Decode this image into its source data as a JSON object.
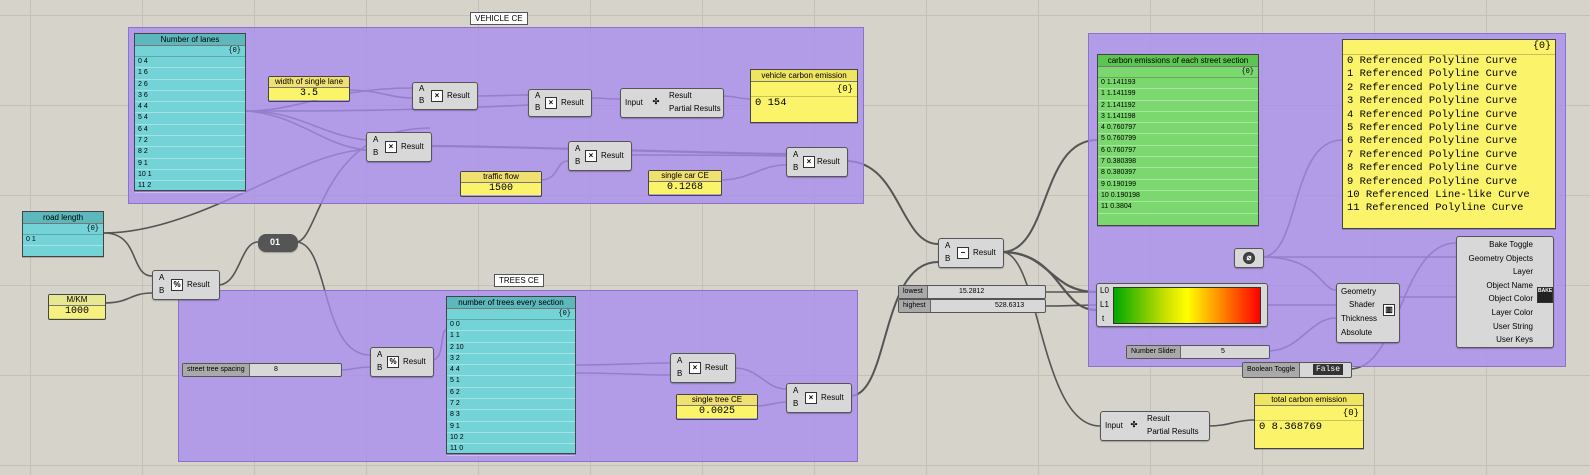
{
  "groups": {
    "vehicle_title": "VEHICLE CE",
    "trees_title": "TREES CE"
  },
  "lanes_panel": {
    "title": "Number of lanes",
    "index": "{0}",
    "rows": [
      "0 4",
      "1 6",
      "2 6",
      "3 6",
      "4 4",
      "5 4",
      "6 4",
      "7 2",
      "8 2",
      "9 1",
      "10 1",
      "11 2"
    ]
  },
  "road_length": {
    "title": "road length",
    "index": "{0}",
    "row": "0 1"
  },
  "mkm": {
    "title": "M/KM",
    "value": "1000"
  },
  "width_lane": {
    "title": "width of single lane",
    "value": "3.5"
  },
  "traffic_flow": {
    "title": "traffic flow",
    "value": "1500"
  },
  "single_car": {
    "title": "single car CE",
    "value": "0.1268"
  },
  "single_tree": {
    "title": "single tree CE",
    "value": "0.0025"
  },
  "vehicle_ce_panel": {
    "title": "vehicle carbon emission",
    "index": "{0}",
    "row": "0 154"
  },
  "total_ce_panel": {
    "title": "total carbon emission",
    "index": "{0}",
    "row": "0 8.368769"
  },
  "trees_panel": {
    "title": "number of trees every section",
    "index": "{0}",
    "rows": [
      "0 0",
      "1 1",
      "2 10",
      "3 2",
      "4 4",
      "5 1",
      "6 2",
      "7 2",
      "8 3",
      "9 1",
      "10 2",
      "11 0"
    ]
  },
  "ce_section_panel": {
    "title": "carbon emissions of each street section",
    "index": "{0}",
    "rows": [
      "0 1.141193",
      "1 1.141199",
      "2 1.141192",
      "3 1.141198",
      "4 0.760797",
      "5 0.760799",
      "6 0.760797",
      "7 0.380398",
      "8 0.380397",
      "9 0.190199",
      "10 0.190198",
      "11 0.3804"
    ]
  },
  "geometry_panel": {
    "index": "{0}",
    "rows": [
      "0 Referenced Polyline Curve",
      "1 Referenced Polyline Curve",
      "2 Referenced Polyline Curve",
      "3 Referenced Polyline Curve",
      "4 Referenced Polyline Curve",
      "5 Referenced Polyline Curve",
      "6 Referenced Polyline Curve",
      "7 Referenced Polyline Curve",
      "8 Referenced Polyline Curve",
      "9 Referenced Polyline Curve",
      "10 Referenced Line-like Curve",
      "11 Referenced Polyline Curve"
    ]
  },
  "labels": {
    "a": "A",
    "b": "B",
    "result": "Result",
    "input": "Input",
    "partial": "Partial Results",
    "relay": "01",
    "l0": "L0",
    "l1": "L1",
    "t": "t"
  },
  "street_tree_slider": {
    "label": "street tree spacing",
    "value": "8"
  },
  "lowest_slider": {
    "label": "lowest",
    "value": "15.2812"
  },
  "highest_slider": {
    "label": "highest",
    "value": "528.6313"
  },
  "number_slider": {
    "label": "Number Slider",
    "value": "5"
  },
  "boolean_toggle": {
    "label": "Boolean Toggle",
    "value": "False"
  },
  "preview": {
    "geometry": "Geometry",
    "shader": "Shader",
    "thickness": "Thickness",
    "absolute": "Absolute"
  },
  "bake": {
    "inputs": [
      "Bake Toggle",
      "Geometry Objects",
      "Layer",
      "Object Name",
      "Object Color",
      "Layer Color",
      "User String",
      "User Keys"
    ],
    "icon_text": "BAKE"
  },
  "colors": {
    "group": "#a88cee",
    "cyan": "#74d3d6",
    "green": "#7ad86e",
    "yellow": "#fbf46a"
  }
}
